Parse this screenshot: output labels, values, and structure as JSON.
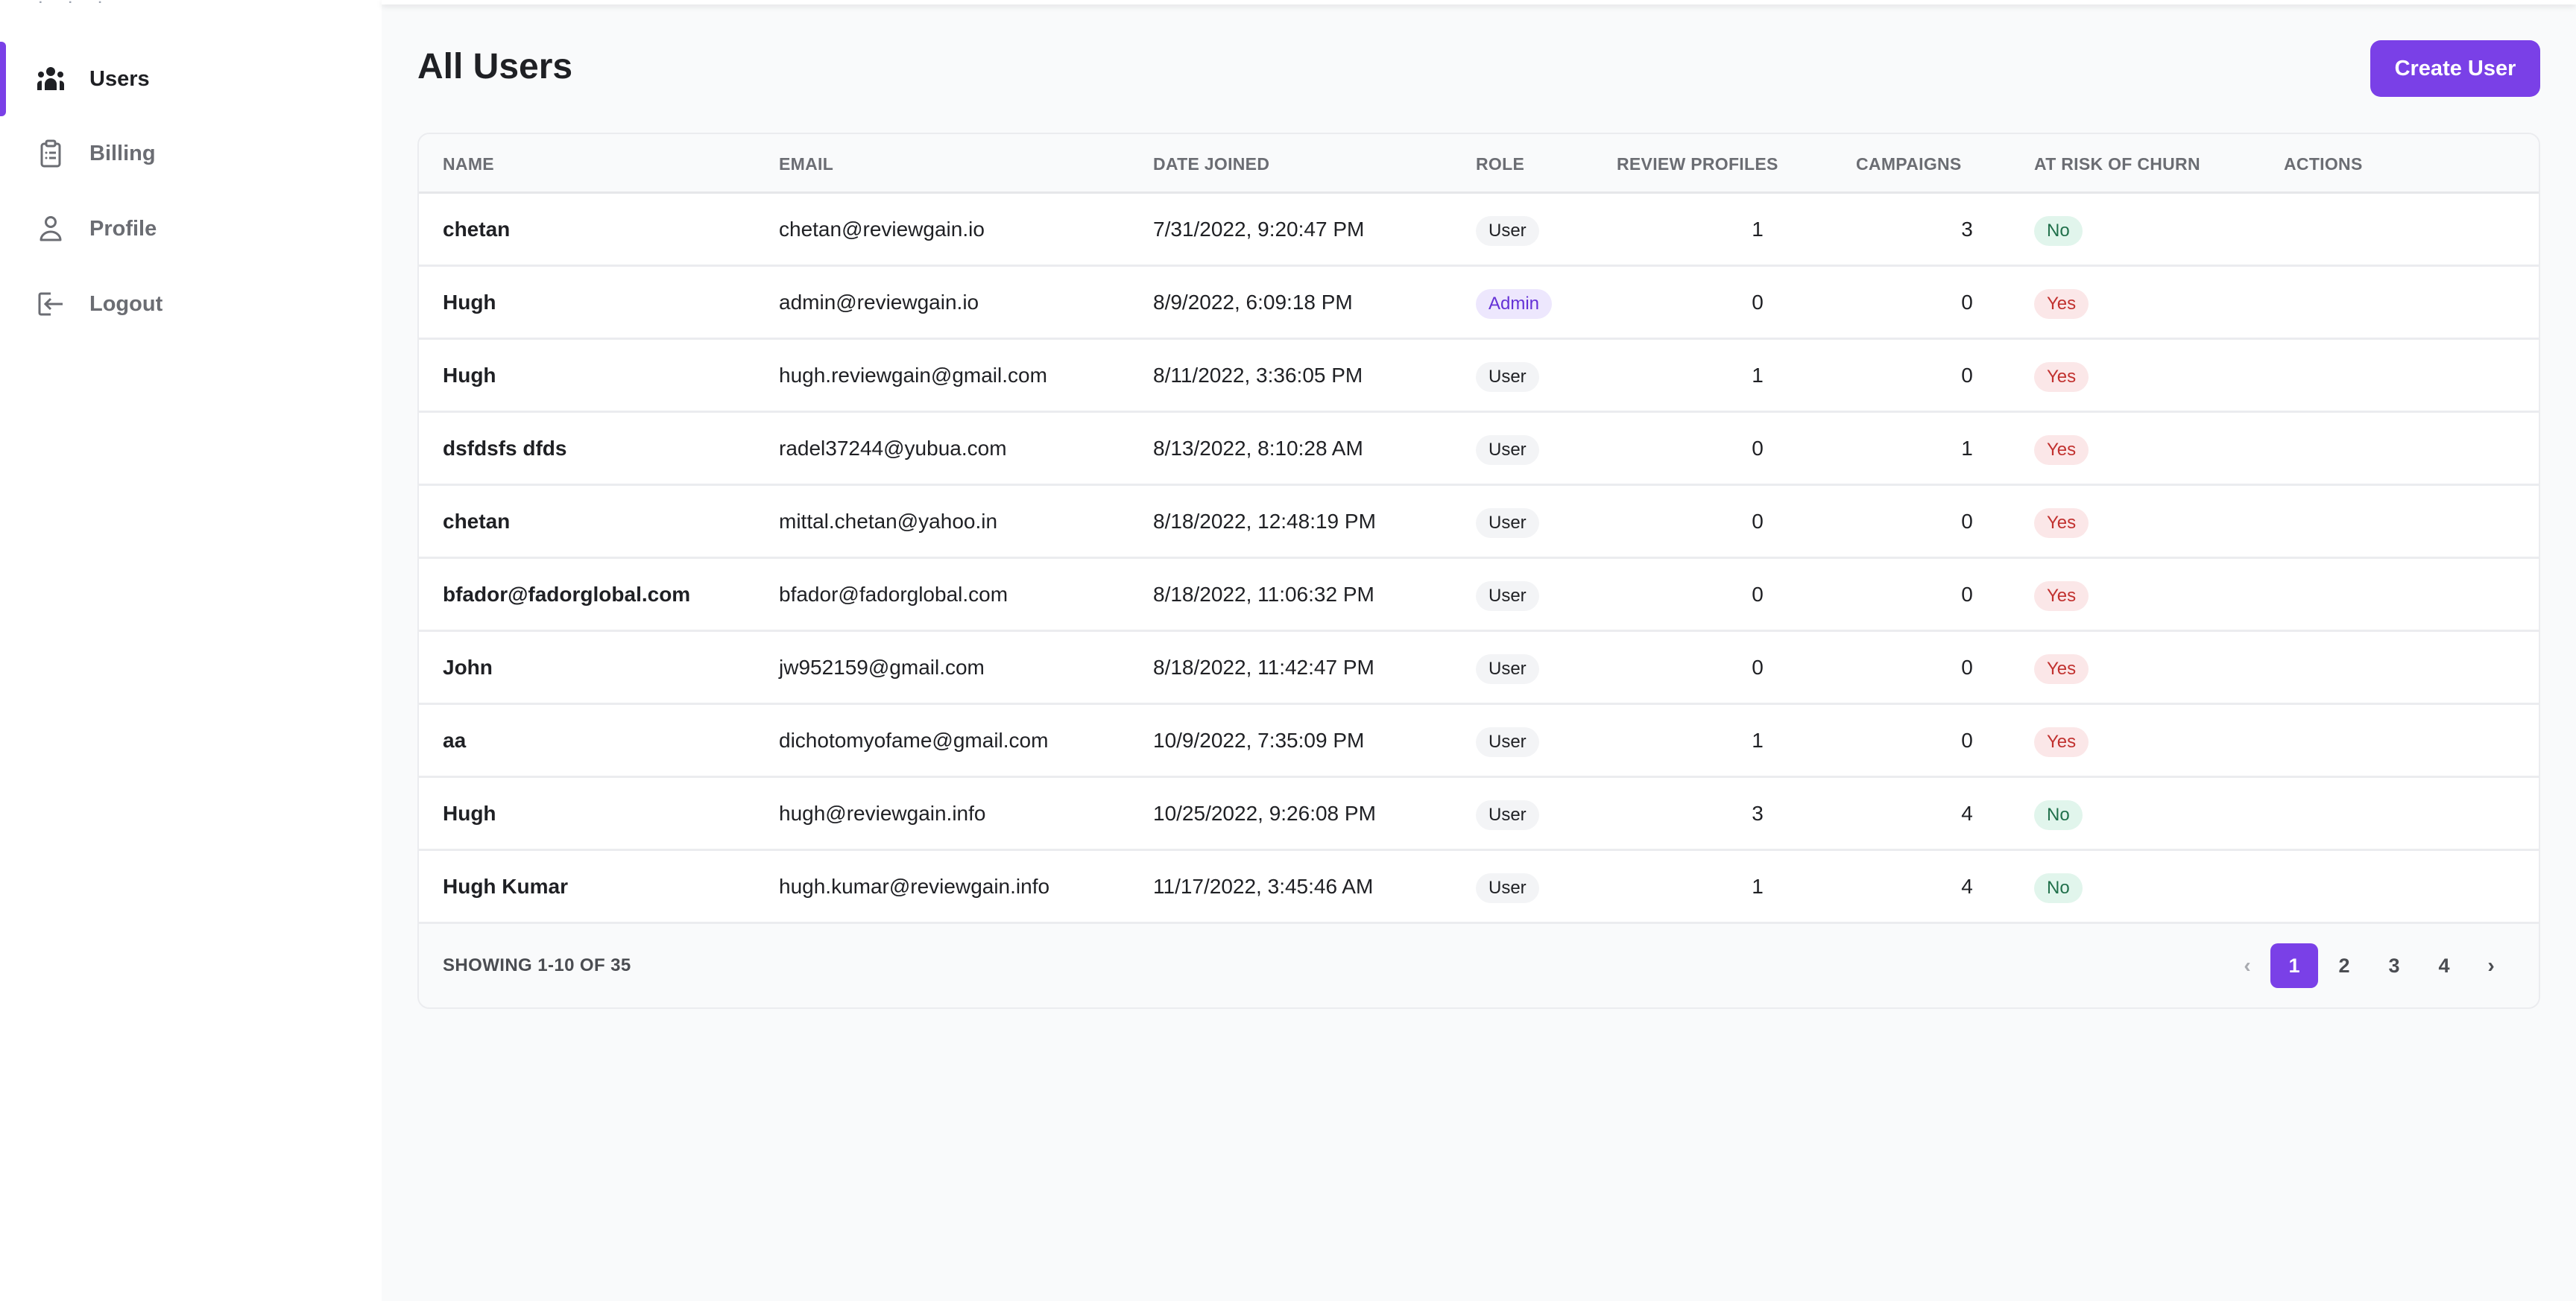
{
  "sidebar": {
    "items": [
      {
        "label": "Users",
        "icon": "users-icon",
        "active": true
      },
      {
        "label": "Billing",
        "icon": "clipboard-list-icon",
        "active": false
      },
      {
        "label": "Profile",
        "icon": "user-icon",
        "active": false
      },
      {
        "label": "Logout",
        "icon": "logout-icon",
        "active": false
      }
    ]
  },
  "header": {
    "title": "All Users",
    "create_button": "Create User"
  },
  "colors": {
    "accent": "#7a40e7",
    "churn_yes_bg": "#fbe7e8",
    "churn_yes_text": "#c1312f",
    "churn_no_bg": "#e1f5ec",
    "churn_no_text": "#21704b",
    "admin_bg": "#ede7fd",
    "admin_text": "#6431d6"
  },
  "table": {
    "columns": [
      "NAME",
      "EMAIL",
      "DATE JOINED",
      "ROLE",
      "REVIEW PROFILES",
      "CAMPAIGNS",
      "AT RISK OF CHURN",
      "ACTIONS"
    ],
    "action_icons": [
      "login-as-icon",
      "view-user-icon",
      "edit-icon",
      "delete-icon"
    ],
    "rows": [
      {
        "name": "chetan",
        "email": "chetan@reviewgain.io",
        "date_joined": "7/31/2022, 9:20:47 PM",
        "role": "User",
        "review_profiles": "1",
        "campaigns": "3",
        "at_risk": "No"
      },
      {
        "name": "Hugh",
        "email": "admin@reviewgain.io",
        "date_joined": "8/9/2022, 6:09:18 PM",
        "role": "Admin",
        "review_profiles": "0",
        "campaigns": "0",
        "at_risk": "Yes"
      },
      {
        "name": "Hugh",
        "email": "hugh.reviewgain@gmail.com",
        "date_joined": "8/11/2022, 3:36:05 PM",
        "role": "User",
        "review_profiles": "1",
        "campaigns": "0",
        "at_risk": "Yes"
      },
      {
        "name": "dsfdsfs dfds",
        "email": "radel37244@yubua.com",
        "date_joined": "8/13/2022, 8:10:28 AM",
        "role": "User",
        "review_profiles": "0",
        "campaigns": "1",
        "at_risk": "Yes"
      },
      {
        "name": "chetan",
        "email": "mittal.chetan@yahoo.in",
        "date_joined": "8/18/2022, 12:48:19 PM",
        "role": "User",
        "review_profiles": "0",
        "campaigns": "0",
        "at_risk": "Yes"
      },
      {
        "name": "bfador@fadorglobal.com",
        "email": "bfador@fadorglobal.com",
        "date_joined": "8/18/2022, 11:06:32 PM",
        "role": "User",
        "review_profiles": "0",
        "campaigns": "0",
        "at_risk": "Yes"
      },
      {
        "name": "John",
        "email": "jw952159@gmail.com",
        "date_joined": "8/18/2022, 11:42:47 PM",
        "role": "User",
        "review_profiles": "0",
        "campaigns": "0",
        "at_risk": "Yes"
      },
      {
        "name": "aa",
        "email": "dichotomyofame@gmail.com",
        "date_joined": "10/9/2022, 7:35:09 PM",
        "role": "User",
        "review_profiles": "1",
        "campaigns": "0",
        "at_risk": "Yes",
        "focused_action": "delete"
      },
      {
        "name": "Hugh",
        "email": "hugh@reviewgain.info",
        "date_joined": "10/25/2022, 9:26:08 PM",
        "role": "User",
        "review_profiles": "3",
        "campaigns": "4",
        "at_risk": "No"
      },
      {
        "name": "Hugh Kumar",
        "email": "hugh.kumar@reviewgain.info",
        "date_joined": "11/17/2022, 3:45:46 AM",
        "role": "User",
        "review_profiles": "1",
        "campaigns": "4",
        "at_risk": "No"
      }
    ]
  },
  "footer": {
    "showing": "SHOWING 1-10 OF 35",
    "pagination": {
      "prev": "‹",
      "next": "›",
      "pages": [
        "1",
        "2",
        "3",
        "4"
      ],
      "current": "1"
    }
  }
}
